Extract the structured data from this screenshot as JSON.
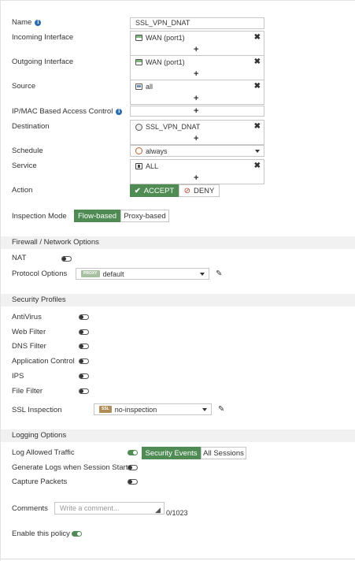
{
  "form": {
    "name": {
      "label": "Name",
      "value": "SSL_VPN_DNAT"
    },
    "incoming_interface": {
      "label": "Incoming Interface",
      "value": "WAN (port1)",
      "icon": "interface-icon"
    },
    "outgoing_interface": {
      "label": "Outgoing Interface",
      "value": "WAN (port1)",
      "icon": "interface-icon"
    },
    "source": {
      "label": "Source",
      "value": "all",
      "icon": "address-icon"
    },
    "ip_mac": {
      "label": "IP/MAC Based Access Control"
    },
    "destination": {
      "label": "Destination",
      "value": "SSL_VPN_DNAT",
      "icon": "vip-icon"
    },
    "schedule": {
      "label": "Schedule",
      "value": "always",
      "icon": "clock-icon"
    },
    "service": {
      "label": "Service",
      "value": "ALL",
      "icon": "service-icon"
    },
    "action": {
      "label": "Action",
      "accept": "ACCEPT",
      "deny": "DENY",
      "selected": "accept"
    },
    "inspection_mode": {
      "label": "Inspection Mode",
      "flow": "Flow-based",
      "proxy": "Proxy-based",
      "selected": "flow"
    },
    "plus": "+",
    "remove": "✖"
  },
  "firewall_options": {
    "header": "Firewall / Network Options",
    "nat": {
      "label": "NAT",
      "enabled": false
    },
    "protocol_options": {
      "label": "Protocol Options",
      "badge": "PROXY",
      "value": "default"
    }
  },
  "security_profiles": {
    "header": "Security Profiles",
    "items": [
      {
        "label": "AntiVirus",
        "enabled": false
      },
      {
        "label": "Web Filter",
        "enabled": false
      },
      {
        "label": "DNS Filter",
        "enabled": false
      },
      {
        "label": "Application Control",
        "enabled": false
      },
      {
        "label": "IPS",
        "enabled": false
      },
      {
        "label": "File Filter",
        "enabled": false
      }
    ],
    "ssl_inspection": {
      "label": "SSL Inspection",
      "badge": "SSL",
      "value": "no-inspection"
    }
  },
  "logging": {
    "header": "Logging Options",
    "log_allowed": {
      "label": "Log Allowed Traffic",
      "enabled": true,
      "security_events": "Security Events",
      "all_sessions": "All Sessions",
      "selected": "security_events"
    },
    "log_session_start": {
      "label": "Generate Logs when Session Starts",
      "enabled": false
    },
    "capture_packets": {
      "label": "Capture Packets",
      "enabled": false
    }
  },
  "comments": {
    "label": "Comments",
    "placeholder": "Write a comment...",
    "counter": "0/1023"
  },
  "enable_policy": {
    "label": "Enable this policy",
    "enabled": true
  },
  "colors": {
    "accent_green": "#4f8c54",
    "info_blue": "#2a6bb7",
    "section_bg": "#f1f1f1",
    "deny_red": "#c0392b",
    "badge_tan": "#b08d57"
  }
}
